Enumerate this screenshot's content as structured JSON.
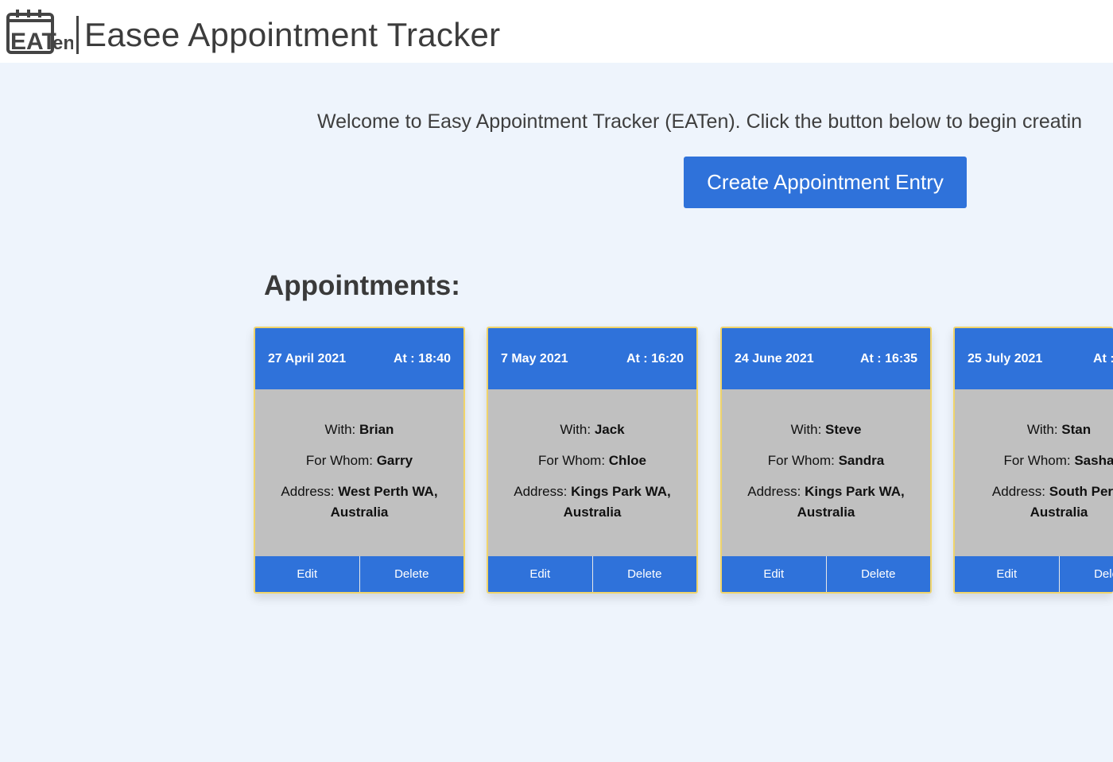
{
  "header": {
    "logo_text": "EATen",
    "title": "Easee Appointment Tracker"
  },
  "main": {
    "welcome": "Welcome to Easy Appointment Tracker (EATen). Click the button below to begin creatin",
    "create_button": "Create Appointment Entry",
    "section_title": "Appointments:"
  },
  "labels": {
    "with": "With: ",
    "for_whom": "For Whom: ",
    "address": "Address: ",
    "edit": "Edit",
    "delete": "Delete"
  },
  "appointments": [
    {
      "date": "27 April 2021",
      "time": "At : 18:40",
      "with": "Brian",
      "for_whom": "Garry",
      "address_1": "West Perth WA,",
      "address_2": "Australia"
    },
    {
      "date": "7 May 2021",
      "time": "At : 16:20",
      "with": "Jack",
      "for_whom": "Chloe",
      "address_1": "Kings Park WA,",
      "address_2": "Australia"
    },
    {
      "date": "24 June 2021",
      "time": "At : 16:35",
      "with": "Steve",
      "for_whom": "Sandra",
      "address_1": "Kings Park WA,",
      "address_2": "Australia"
    },
    {
      "date": "25 July 2021",
      "time": "At :",
      "with": "Stan",
      "for_whom": "Sasha",
      "address_1": "South Perth",
      "address_2": "Australia"
    }
  ],
  "colors": {
    "primary": "#2f72da",
    "card_border": "#f0d46a",
    "card_body": "#c0c0c0",
    "page_bg": "#eef4fc"
  }
}
